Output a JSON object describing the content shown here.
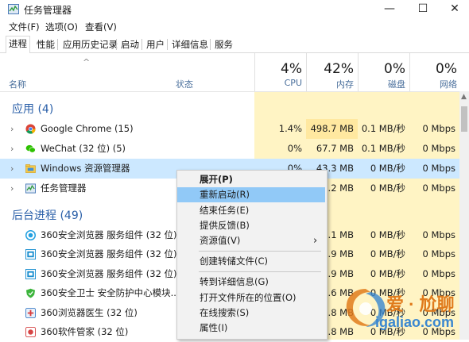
{
  "window": {
    "title": "任务管理器",
    "minimize": "—",
    "maximize": "☐",
    "close": "✕"
  },
  "menu": [
    "文件(F)",
    "选项(O)",
    "查看(V)"
  ],
  "tabs": [
    "进程",
    "性能",
    "应用历史记录",
    "启动",
    "用户",
    "详细信息",
    "服务"
  ],
  "header": {
    "sort_arrow": "^",
    "name": "名称",
    "status": "状态",
    "cpu_pct": "4%",
    "cpu": "CPU",
    "mem_pct": "42%",
    "mem": "内存",
    "disk_pct": "0%",
    "disk": "磁盘",
    "net_pct": "0%",
    "net": "网络"
  },
  "groups": {
    "apps": "应用 (4)",
    "background": "后台进程 (49)"
  },
  "apps": [
    {
      "name": "Google Chrome (15)",
      "cpu": "1.4%",
      "mem": "498.7 MB",
      "disk": "0.1 MB/秒",
      "net": "0 Mbps"
    },
    {
      "name": "WeChat (32 位) (5)",
      "cpu": "0%",
      "mem": "67.7 MB",
      "disk": "0.1 MB/秒",
      "net": "0 Mbps"
    },
    {
      "name": "Windows 资源管理器",
      "cpu": "0%",
      "mem": "43.3 MB",
      "disk": "0 MB/秒",
      "net": "0 Mbps"
    },
    {
      "name": "任务管理器",
      "cpu": "",
      "mem": ".2 MB",
      "disk": "0 MB/秒",
      "net": "0 Mbps"
    }
  ],
  "background": [
    {
      "name": "360安全浏览器 服务组件 (32 位)",
      "mem": ".1 MB",
      "disk": "0 MB/秒",
      "net": "0 Mbps"
    },
    {
      "name": "360安全浏览器 服务组件 (32 位)",
      "mem": ".9 MB",
      "disk": "0 MB/秒",
      "net": "0 Mbps"
    },
    {
      "name": "360安全浏览器 服务组件 (32 位)",
      "mem": ".9 MB",
      "disk": "0 MB/秒",
      "net": "0 Mbps"
    },
    {
      "name": "360安全卫士 安全防护中心模块...",
      "mem": ".6 MB",
      "disk": "0 MB/秒",
      "net": "0 Mbps"
    },
    {
      "name": "360浏览器医生 (32 位)",
      "mem": ".8 MB",
      "disk": "0 MB/秒",
      "net": "0 Mbps"
    },
    {
      "name": "360软件管家 (32 位)",
      "mem": ".8 MB",
      "disk": "0 MB/秒",
      "net": "0 Mbps"
    }
  ],
  "context_menu": [
    {
      "label": "展开(P)",
      "bold": true
    },
    {
      "label": "重新启动(R)",
      "highlight": true
    },
    {
      "label": "结束任务(E)"
    },
    {
      "label": "提供反馈(B)"
    },
    {
      "label": "资源值(V)",
      "submenu": "›"
    },
    {
      "label": "创建转储文件(C)"
    },
    {
      "label": "转到详细信息(G)"
    },
    {
      "label": "打开文件所在的位置(O)"
    },
    {
      "label": "在线搜索(S)"
    },
    {
      "label": "属性(I)"
    }
  ],
  "watermark": {
    "brand": "爱 · 尬聊",
    "url": "igaliao.com"
  },
  "colors": {
    "accent": "#2a5fa8",
    "heat_light": "#fff4c4",
    "heat_dark": "#ffe8a0",
    "menu_highlight": "#91c9f7"
  }
}
